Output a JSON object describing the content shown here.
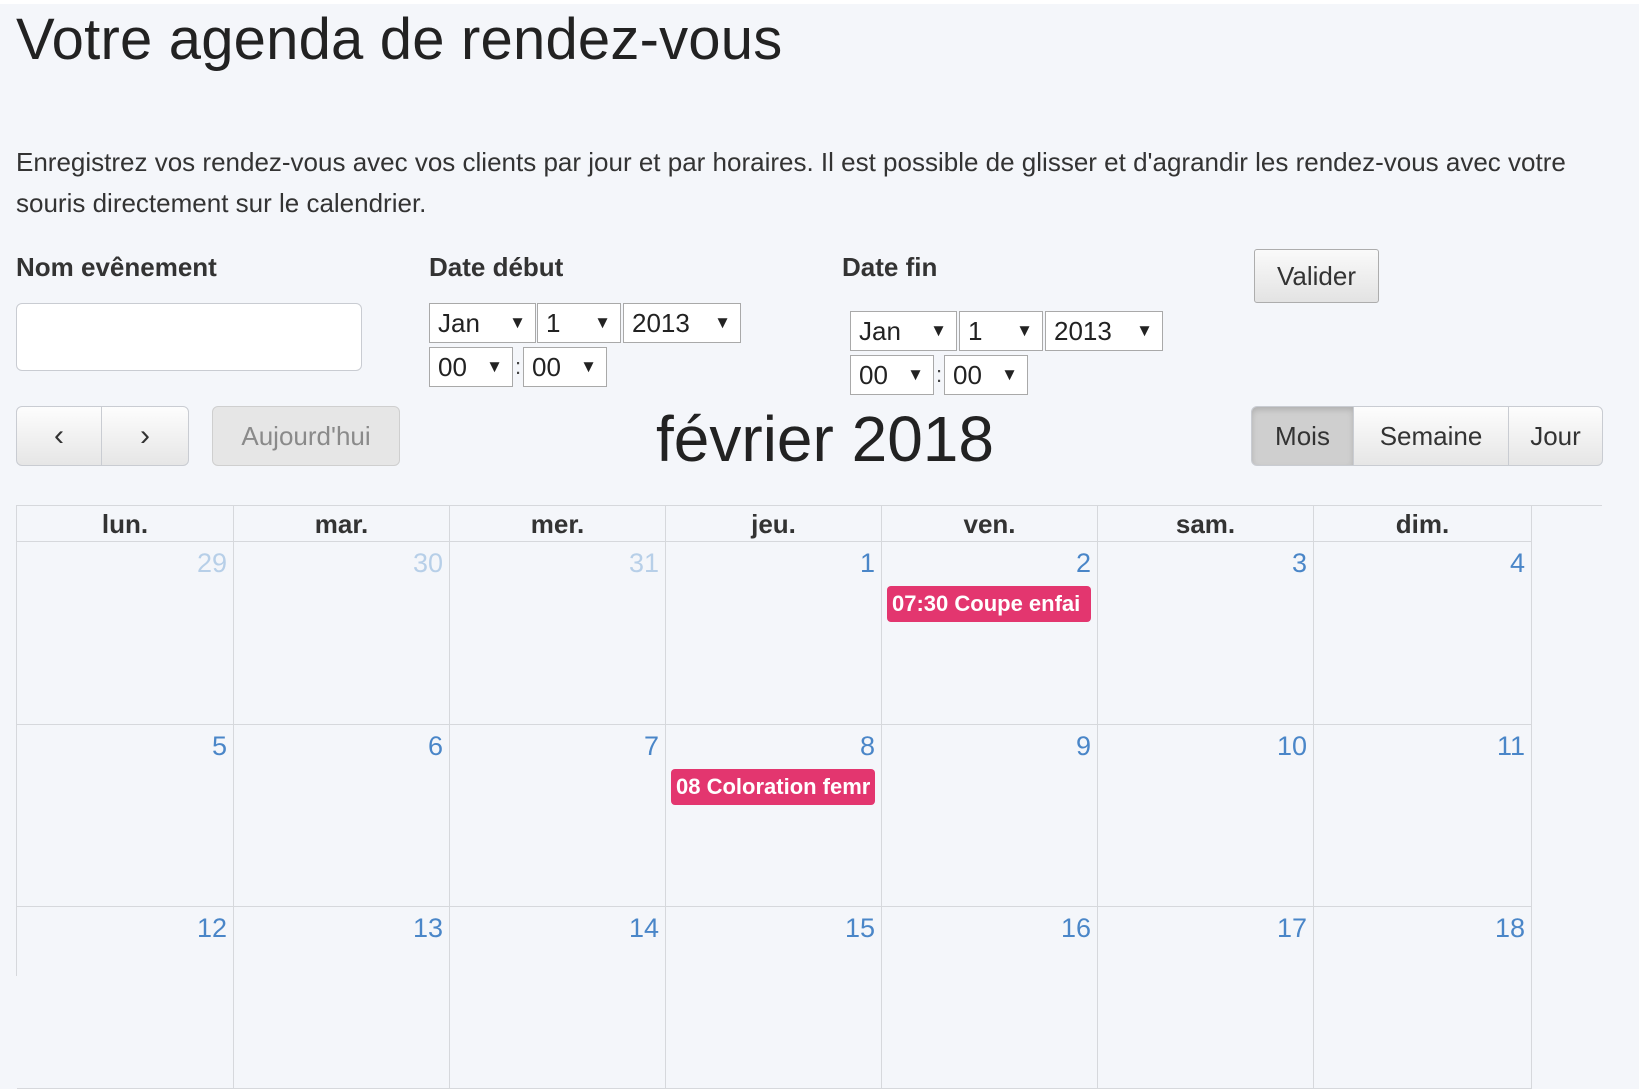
{
  "page": {
    "title": "Votre agenda de rendez-vous",
    "description": "Enregistrez vos rendez-vous avec vos clients par jour et par horaires. Il est possible de glisser et d'agrandir les rendez-vous avec votre souris directement sur le calendrier."
  },
  "form": {
    "name_label": "Nom evênement",
    "name_value": "",
    "start_label": "Date début",
    "end_label": "Date fin",
    "start": {
      "month": "Jan",
      "day": "1",
      "year": "2013",
      "hour": "00",
      "minute": "00"
    },
    "end": {
      "month": "Jan",
      "day": "1",
      "year": "2013",
      "hour": "00",
      "minute": "00"
    },
    "submit_label": "Valider"
  },
  "toolbar": {
    "prev_icon": "chevron-left-icon",
    "next_icon": "chevron-right-icon",
    "prev_glyph": "‹",
    "next_glyph": "›",
    "today_label": "Aujourd'hui",
    "month_title": "février 2018",
    "views": [
      "Mois",
      "Semaine",
      "Jour"
    ],
    "active_view": "Mois"
  },
  "calendar": {
    "weekdays": [
      "lun.",
      "mar.",
      "mer.",
      "jeu.",
      "ven.",
      "sam.",
      "dim."
    ],
    "weeks": [
      [
        {
          "day": "29",
          "other": true
        },
        {
          "day": "30",
          "other": true
        },
        {
          "day": "31",
          "other": true
        },
        {
          "day": "1"
        },
        {
          "day": "2",
          "event": "07:30 Coupe enfai"
        },
        {
          "day": "3"
        },
        {
          "day": "4"
        }
      ],
      [
        {
          "day": "5"
        },
        {
          "day": "6"
        },
        {
          "day": "7"
        },
        {
          "day": "8",
          "event": "08 Coloration femr"
        },
        {
          "day": "9"
        },
        {
          "day": "10"
        },
        {
          "day": "11"
        }
      ],
      [
        {
          "day": "12"
        },
        {
          "day": "13"
        },
        {
          "day": "14"
        },
        {
          "day": "15"
        },
        {
          "day": "16"
        },
        {
          "day": "17"
        },
        {
          "day": "18"
        }
      ]
    ],
    "event_color": "#e3366f",
    "day_number_color": "#4a86c8",
    "other_month_color": "#b7cfe8"
  }
}
